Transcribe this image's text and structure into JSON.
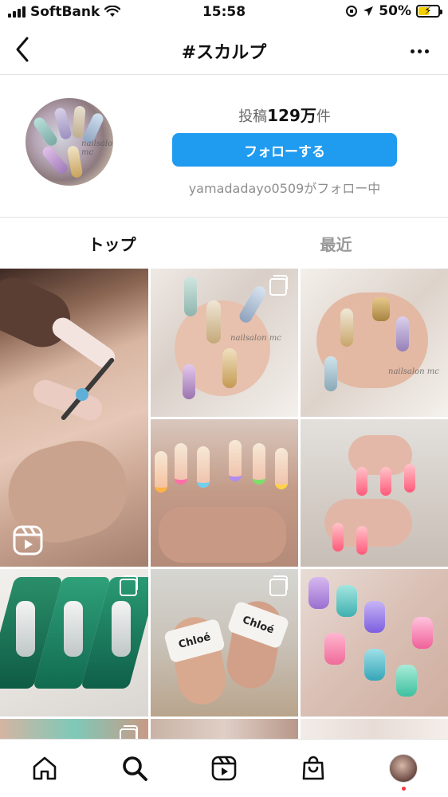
{
  "status_bar": {
    "carrier": "SoftBank",
    "time": "15:58",
    "battery": "50%"
  },
  "header": {
    "title": "#スカルプ",
    "back_icon": "chevron-left-icon",
    "more_icon": "more-horizontal-icon"
  },
  "profile": {
    "posts_prefix": "投稿",
    "posts_count": "129万",
    "posts_suffix": "件",
    "follow_button": "フォローする",
    "followed_by": "yamadadayo0509がフォロー中",
    "avatar_watermark": "nailsalon mc"
  },
  "tabs": [
    {
      "label": "トップ",
      "active": true
    },
    {
      "label": "最近",
      "active": false
    }
  ],
  "grid": {
    "watermarks": [
      "nailsalon mc",
      "nailsalon mc"
    ],
    "sandal_text": [
      "Chloé",
      "Chloé"
    ]
  },
  "bottom_nav": [
    {
      "name": "home-icon"
    },
    {
      "name": "search-icon",
      "active": true
    },
    {
      "name": "reels-icon"
    },
    {
      "name": "shop-icon"
    },
    {
      "name": "profile-avatar"
    }
  ],
  "colors": {
    "accent": "#1f9bf0",
    "notification_dot": "#ff3040"
  }
}
